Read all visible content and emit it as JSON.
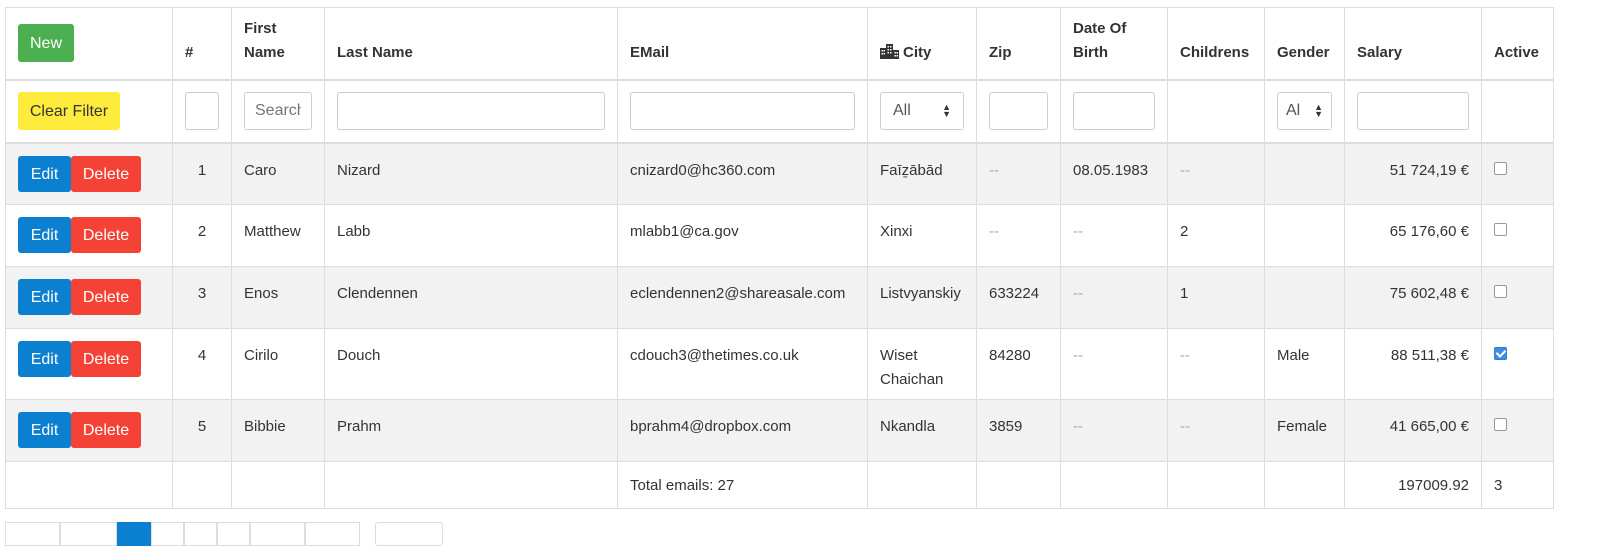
{
  "toolbar": {
    "new_label": "New",
    "clear_filter_label": "Clear Filter"
  },
  "columns": {
    "num": "#",
    "first_name_1": "First",
    "first_name_2": "Name",
    "last_name": "Last Name",
    "email": "EMail",
    "city": "City",
    "zip": "Zip",
    "dob_1": "Date Of",
    "dob_2": "Birth",
    "childrens": "Childrens",
    "gender": "Gender",
    "salary": "Salary",
    "active": "Active"
  },
  "filters": {
    "first_name_placeholder": "Search",
    "city_select": "All",
    "gender_select": "Al"
  },
  "row_actions": {
    "edit": "Edit",
    "delete": "Delete"
  },
  "empty_marker": "--",
  "rows": [
    {
      "num": "1",
      "first": "Caro",
      "last": "Nizard",
      "email": "cnizard0@hc360.com",
      "city": "Faīẕābād",
      "zip": "--",
      "dob": "08.05.1983",
      "childrens": "--",
      "gender": "",
      "salary": "51 724,19 €",
      "active": false
    },
    {
      "num": "2",
      "first": "Matthew",
      "last": "Labb",
      "email": "mlabb1@ca.gov",
      "city": "Xinxi",
      "zip": "--",
      "dob": "--",
      "childrens": "2",
      "gender": "",
      "salary": "65 176,60 €",
      "active": false
    },
    {
      "num": "3",
      "first": "Enos",
      "last": "Clendennen",
      "email": "eclendennen2@shareasale.com",
      "city": "Listvyanskiy",
      "zip": "633224",
      "dob": "--",
      "childrens": "1",
      "gender": "",
      "salary": "75 602,48 €",
      "active": false
    },
    {
      "num": "4",
      "first": "Cirilo",
      "last": "Douch",
      "email": "cdouch3@thetimes.co.uk",
      "city_1": "Wiset",
      "city_2": "Chaichan",
      "zip": "84280",
      "dob": "--",
      "childrens": "--",
      "gender": "Male",
      "salary": "88 511,38 €",
      "active": true
    },
    {
      "num": "5",
      "first": "Bibbie",
      "last": "Prahm",
      "email": "bprahm4@dropbox.com",
      "city": "Nkandla",
      "zip": "3859",
      "dob": "--",
      "childrens": "--",
      "gender": "Female",
      "salary": "41 665,00 €",
      "active": false
    }
  ],
  "footer": {
    "total_emails": "Total emails: 27",
    "salary_total": "197009.92",
    "active_total": "3"
  },
  "colors": {
    "new": "#4caf50",
    "clear": "#ffeb3b",
    "edit": "#0b7fd0",
    "delete": "#f44336",
    "stripe": "#f2f2f2"
  }
}
